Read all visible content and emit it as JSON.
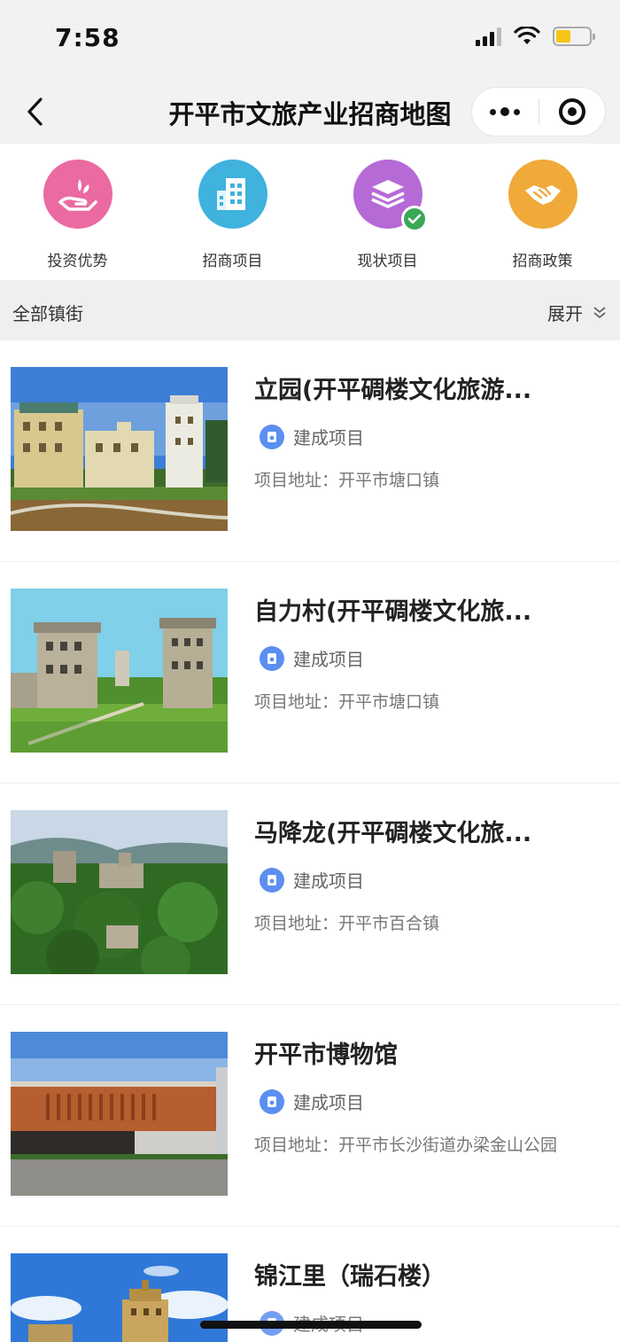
{
  "status_bar": {
    "time": "7:58"
  },
  "nav": {
    "title": "开平市文旅产业招商地图"
  },
  "categories": [
    {
      "label": "投资优势",
      "icon": "hand-money-icon",
      "color": "#ea6aa1"
    },
    {
      "label": "招商项目",
      "icon": "building-icon",
      "color": "#3fb2dd"
    },
    {
      "label": "现状项目",
      "icon": "layers-icon",
      "color": "#b66ad6"
    },
    {
      "label": "招商政策",
      "icon": "handshake-icon",
      "color": "#efaa3a"
    }
  ],
  "filter": {
    "scope": "全部镇街",
    "expand_label": "展开"
  },
  "projects": [
    {
      "title": "立园(开平碉楼文化旅游...",
      "tag": "建成项目",
      "address": "项目地址：开平市塘口镇",
      "image": "villa-garden-photo"
    },
    {
      "title": "自力村(开平碉楼文化旅...",
      "tag": "建成项目",
      "address": "项目地址：开平市塘口镇",
      "image": "watchtower-village-photo"
    },
    {
      "title": "马降龙(开平碉楼文化旅...",
      "tag": "建成项目",
      "address": "项目地址：开平市百合镇",
      "image": "forest-towers-photo"
    },
    {
      "title": "开平市博物馆",
      "tag": "建成项目",
      "address": "项目地址：开平市长沙街道办梁金山公园",
      "image": "museum-photo"
    },
    {
      "title": "锦江里（瑞石楼）",
      "tag": "建成项目",
      "address": "",
      "image": "ruishi-tower-photo"
    }
  ],
  "colors": {
    "accent_blue": "#5b8ff0",
    "check_green": "#3aa857"
  }
}
